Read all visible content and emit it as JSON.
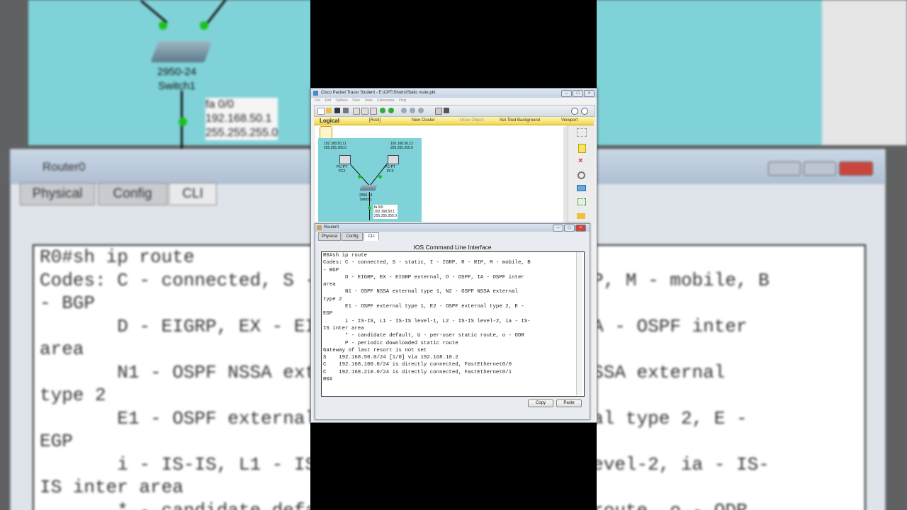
{
  "background": {
    "router_title": "Router0",
    "tabs": [
      "Physical",
      "Config",
      "CLI"
    ],
    "switch_model": "2950-24",
    "switch_name": "Switch1",
    "iface_label": [
      "fa 0/0",
      "192.168.50.1",
      "255.255.255.0"
    ],
    "cli_lines": [
      "R0#sh ip route",
      "Codes: C - connected, S - static, I - IGRP, R - RIP, M - mobile, B",
      "- BGP",
      "       D - EIGRP, EX - EIGRP external, O - OSPF, IA - OSPF inter",
      "area",
      "       N1 - OSPF NSSA external type 1, N2 - OSPF NSSA external",
      "type 2",
      "       E1 - OSPF external type 1, E2 - OSPF external type 2, E -",
      "EGP",
      "       i - IS-IS, L1 - IS-IS level-1, L2 - IS-IS level-2, ia - IS-",
      "IS inter area",
      "       * - candidate default, U - per-user static route, o - ODR"
    ]
  },
  "app": {
    "title": "Cisco Packet Tracer Student - E:\\CPT\\Shorts\\Static route.pkt",
    "menu": [
      "File",
      "Edit",
      "Options",
      "View",
      "Tools",
      "Extensions",
      "Help"
    ],
    "logical_label": "Logical",
    "root_label": "[Root]",
    "new_cluster": "New Cluster",
    "move_object": "Move Object",
    "tiled_bg": "Set Tiled Background",
    "viewport": "Viewport",
    "topology": {
      "pc2_ip": "192.168.50.11",
      "pc2_mask": "255.255.255.0",
      "pc3_ip": "192.168.50.12",
      "pc3_mask": "255.255.255.0",
      "pc2_type": "PC-PT",
      "pc2_name": "PC2",
      "pc3_type": "PC-PT",
      "pc3_name": "PC3",
      "switch_model": "2950-24",
      "switch_name": "Switch1",
      "iface": "fa 0/0",
      "iface_ip": "192.168.50.1",
      "iface_mask": "255.255.255.0"
    }
  },
  "router": {
    "title": "Router0",
    "tabs": [
      "Physical",
      "Config",
      "CLI"
    ],
    "cli_heading": "IOS Command Line Interface",
    "cli_lines": [
      "R0#sh ip route",
      "Codes: C - connected, S - static, I - IGRP, R - RIP, M - mobile, B",
      "- BGP",
      "       D - EIGRP, EX - EIGRP external, O - OSPF, IA - OSPF inter",
      "area",
      "       N1 - OSPF NSSA external type 1, N2 - OSPF NSSA external",
      "type 2",
      "       E1 - OSPF external type 1, E2 - OSPF external type 2, E -",
      "EGP",
      "       i - IS-IS, L1 - IS-IS level-1, L2 - IS-IS level-2, ia - IS-",
      "IS inter area",
      "       * - candidate default, U - per-user static route, o - ODR",
      "       P - periodic downloaded static route",
      "",
      "Gateway of last resort is not set",
      "",
      "S    192.168.50.0/24 [1/0] via 192.168.10.2",
      "C    192.168.100.0/24 is directly connected, FastEthernet0/0",
      "C    192.168.210.0/24 is directly connected, FastEthernet0/1",
      "R0#"
    ],
    "copy_label": "Copy",
    "paste_label": "Paste"
  }
}
